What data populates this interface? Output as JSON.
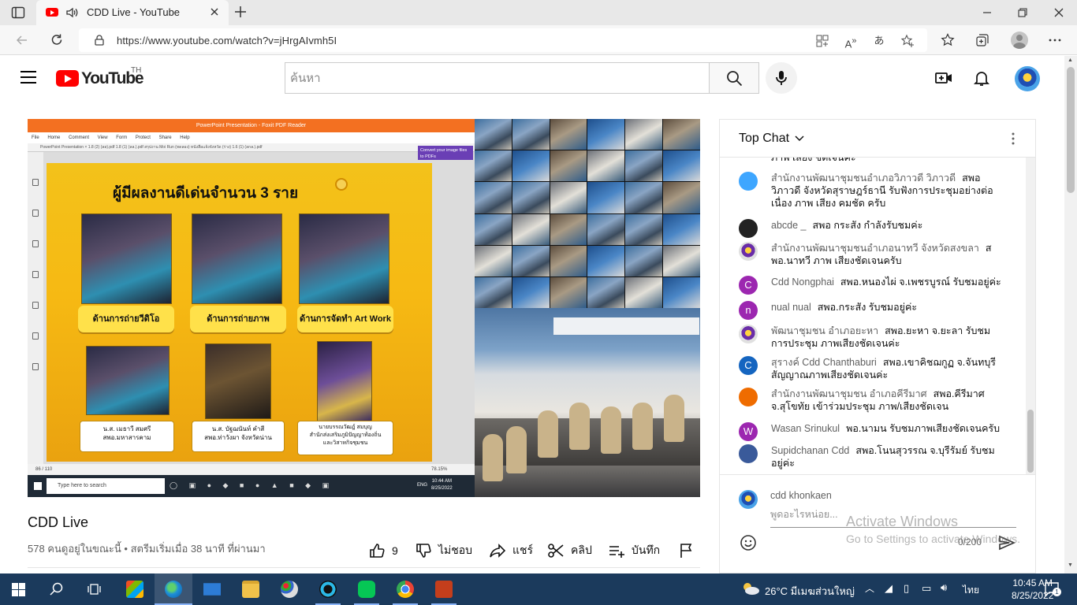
{
  "browser": {
    "tab_title": "CDD Live - YouTube",
    "url": "https://www.youtube.com/watch?v=jHrgAIvmh5I"
  },
  "youtube": {
    "country_code": "TH",
    "logo_text": "YouTube",
    "search_placeholder": "ค้นหา"
  },
  "video": {
    "pdf_window_title": "PowerPoint Presentation - Foxit PDF Reader",
    "pdf_menu": "File Home Comment View Form Protect Share Help",
    "pdf_tabs": "PowerPoint Presentation   ×  1.8 (2) (ลล).pdf   1.8 (1) (ลล.).pdf   สรุปงาน Moi Run (ทดลอง)   หนังสือแจ้งจังหวัด (ร่าง)   1.6 (1) (ลกล.).pdf",
    "pdf_convert": "Convert your image files to PDFs",
    "slide_title": "ผู้มีผลงานดีเด่นจำนวน 3 ราย",
    "caption_1": "ด้านการถ่ายวีดิโอ",
    "caption_2": "ด้านการถ่ายภาพ",
    "caption_3": "ด้านการจัดทำ Art Work",
    "name_1": "น.ส. เมธาวี สมศรี\nสพอ.มหาสารคาม",
    "name_2": "น.ส. บัฐฌนันท์ คำสี\nสพอ.ท่าวังผา จังหวัดน่าน",
    "name_3": "นายบรรณวัฒฎ์ สมบุญ\nสำนักส่งเสริมภูมิปัญญาท้องถิ่น\nและวิสาหกิจชุมชน",
    "pdf_page": "86 / 110",
    "pdf_zoom": "78.15%",
    "inner_search": "Type here to search",
    "inner_time": "10:44 AM",
    "inner_date": "8/25/2022",
    "inner_lang": "ENG",
    "title": "CDD Live",
    "meta": "578 คนดูอยู่ในขณะนี้ • สตรีมเริ่มเมื่อ 38 นาที ที่ผ่านมา"
  },
  "actions": {
    "like_count": "9",
    "dislike": "ไม่ชอบ",
    "share": "แชร์",
    "clip": "คลิป",
    "save": "บันทึก"
  },
  "chat": {
    "header": "Top Chat",
    "partial_top": "ภาพ เสียง ชัดเจนค่ะ",
    "messages": [
      {
        "author": "สำนักงานพัฒนาชุมชนอำเภอวิภาวดี วิภาวดี",
        "text": "สพอ วิภาวดี จังหวัดสุราษฎร์ธานี รับฟังการประชุมอย่างต่อเนื่อง ภาพ เสียง คมชัด ครับ",
        "initial": "",
        "color": "#3ea6ff"
      },
      {
        "author": "abcde _",
        "text": "สพอ กระสัง กำลังรับชมค่ะ",
        "initial": "",
        "color": "#222222"
      },
      {
        "author": "สำนักงานพัฒนาชุมชนอำเภอนาทวี จังหวัดสงขลา",
        "text": "สพอ.นาทวี ภาพ เสียงชัดเจนครับ",
        "initial": "",
        "color": "emblem"
      },
      {
        "author": "Cdd Nongphai",
        "text": "สพอ.หนองไผ่ จ.เพชรบูรณ์ รับชมอยู่ค่ะ",
        "initial": "C",
        "color": "#9c27b0"
      },
      {
        "author": "nual nual",
        "text": "สพอ.กระสัง รับชมอยู่ค่ะ",
        "initial": "n",
        "color": "#9c27b0"
      },
      {
        "author": "พัฒนาชุมชน อำเภอยะหา",
        "text": "สพอ.ยะหา จ.ยะลา รับชมการประชุม ภาพเสียงชัดเจนค่ะ",
        "initial": "",
        "color": "emblem"
      },
      {
        "author": "สุรางค์ Cdd Chanthaburi",
        "text": "สพอ.เขาคิชฌกูฏ จ.จันทบุรี สัญญาณภาพเสียงชัดเจนค่ะ",
        "initial": "C",
        "color": "#1565c0"
      },
      {
        "author": "สำนักงานพัฒนาชุมชน อำเภอคีรีมาศ",
        "text": "สพอ.คีรีมาศ จ.สุโขทัย เข้าร่วมประชุม ภาพ/เสียงชัดเจน",
        "initial": "",
        "color": "#ef6c00"
      },
      {
        "author": "Wasan Srinukul",
        "text": "พอ.นามน รับชมภาพเสียงชัดเจนครับ",
        "initial": "W",
        "color": "#9c27b0"
      },
      {
        "author": "Supidchanan Cdd",
        "text": "สพอ.โนนสุวรรณ จ.บุรีรัมย์ รับชมอยู่ค่ะ",
        "initial": "",
        "color": "#3a5a9a"
      }
    ],
    "me_name": "cdd khonkaen",
    "input_placeholder": "พูดอะไรหน่อย...",
    "counter": "0/200"
  },
  "watermark": {
    "line1": "Activate Windows",
    "line2": "Go to Settings to activate Windows."
  },
  "taskbar": {
    "weather": "26°C  มีเมฆส่วนใหญ่",
    "lang": "ไทย",
    "time": "10:45 AM",
    "date": "8/25/2022",
    "notif_count": "1"
  }
}
